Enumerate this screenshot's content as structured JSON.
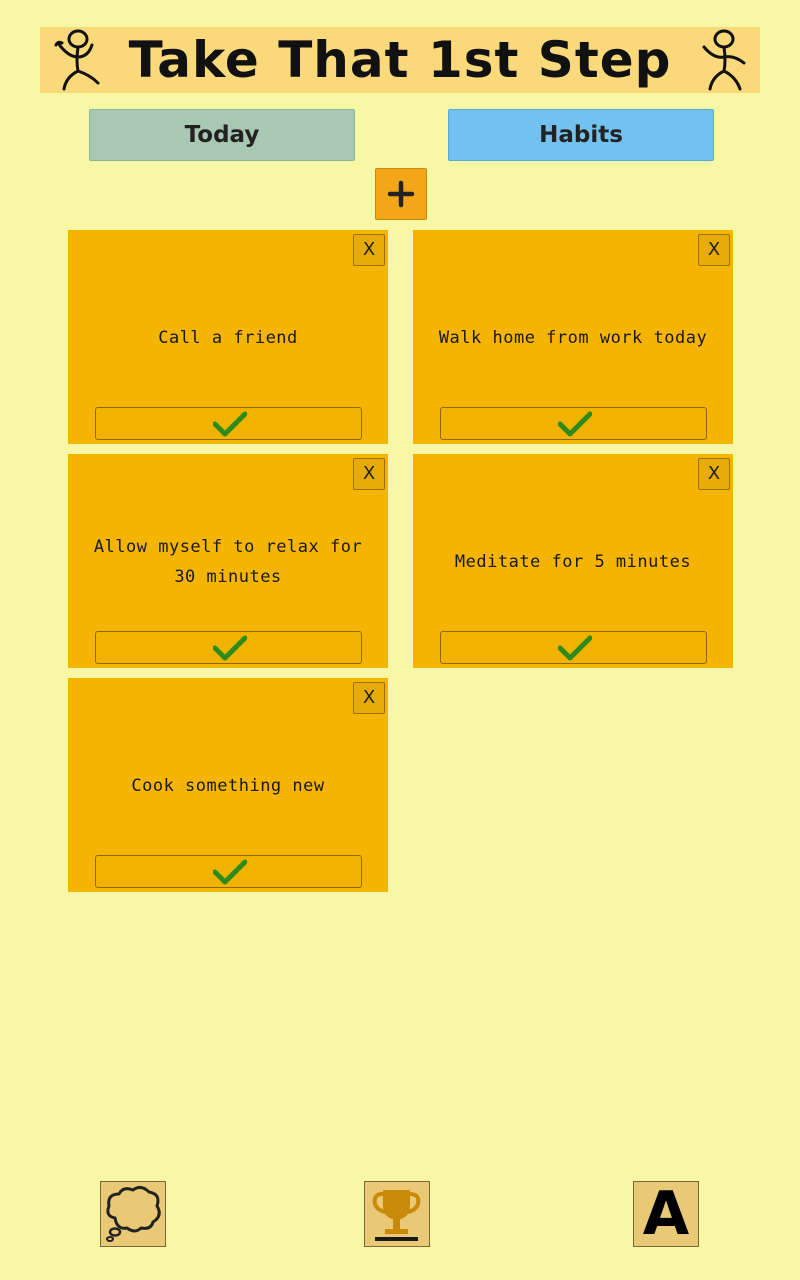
{
  "header": {
    "title": "Take That 1st Step"
  },
  "tabs": {
    "today_label": "Today",
    "habits_label": "Habits"
  },
  "toolbar": {
    "add_icon": "plus-icon"
  },
  "cards": [
    {
      "text": "Call a friend",
      "close_label": "X"
    },
    {
      "text": "Walk home from work today",
      "close_label": "X"
    },
    {
      "text": "Allow myself to relax for 30 minutes",
      "close_label": "X"
    },
    {
      "text": "Meditate for 5 minutes",
      "close_label": "X"
    },
    {
      "text": "Cook something new",
      "close_label": "X"
    }
  ],
  "bottom_nav": {
    "thought_icon": "thought-bubble-icon",
    "trophy_icon": "trophy-icon",
    "font_label": "A"
  },
  "colors": {
    "background": "#f7f7a6",
    "banner": "#f9d97a",
    "card": "#f4b400",
    "today_tab": "#a9c8b3",
    "habits_tab": "#73c1ee",
    "check": "#2e8b1a"
  }
}
